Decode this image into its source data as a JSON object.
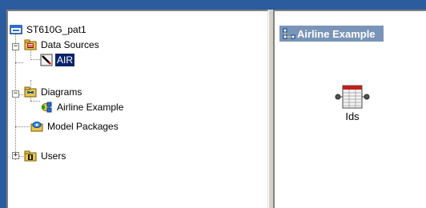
{
  "tree": {
    "root": {
      "label": "ST610G_pat1",
      "icon": "project-icon"
    },
    "data_sources": {
      "label": "Data Sources",
      "icon": "data-sources-folder-icon",
      "expanded": true
    },
    "air": {
      "label": "AIR",
      "icon": "data-source-icon",
      "selected": true
    },
    "diagrams": {
      "label": "Diagrams",
      "icon": "diagrams-folder-icon",
      "expanded": true
    },
    "airline_example": {
      "label": "Airline Example",
      "icon": "diagram-icon"
    },
    "model_packages": {
      "label": "Model Packages",
      "icon": "model-packages-icon"
    },
    "users": {
      "label": "Users",
      "icon": "users-folder-icon",
      "expanded": false
    }
  },
  "diagram": {
    "title": "Airline Example",
    "node": {
      "label": "Ids",
      "icon": "table-node-icon"
    }
  },
  "colors": {
    "selection": "#0a246a",
    "title_bar": "#7a94b8",
    "background": "#2a5c9e"
  }
}
